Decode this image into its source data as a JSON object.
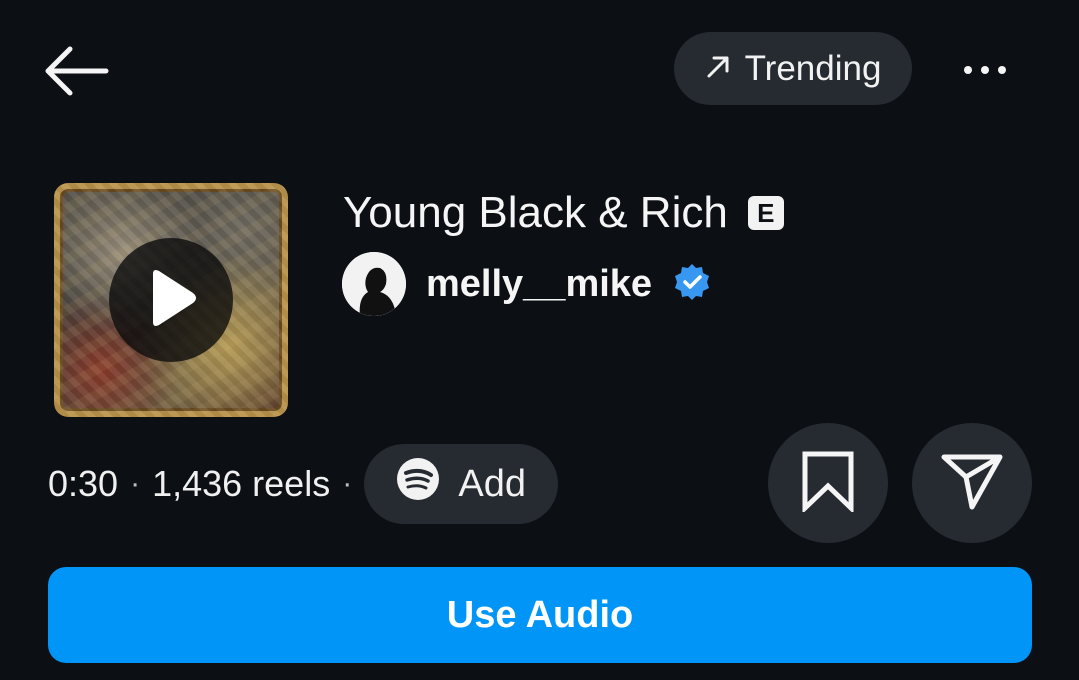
{
  "header": {
    "back_icon": "arrow-left-icon",
    "trending_label": "Trending",
    "trending_icon": "arrow-up-right-icon",
    "more_icon": "more-horizontal-icon"
  },
  "song": {
    "title": "Young Black & Rich",
    "explicit_label": "E",
    "artist": "melly__mike",
    "verified_icon": "verified-badge-icon",
    "album_art_icon": "play-icon"
  },
  "meta": {
    "duration": "0:30",
    "separator": "·",
    "reels_count": "1,436 reels",
    "add_label": "Add",
    "add_icon": "spotify-icon"
  },
  "actions": {
    "save_icon": "bookmark-icon",
    "share_icon": "send-icon",
    "use_audio_label": "Use Audio"
  },
  "colors": {
    "background": "#0c0f14",
    "pill": "#262a31",
    "primary": "#0095f6",
    "verified": "#3897f0"
  }
}
